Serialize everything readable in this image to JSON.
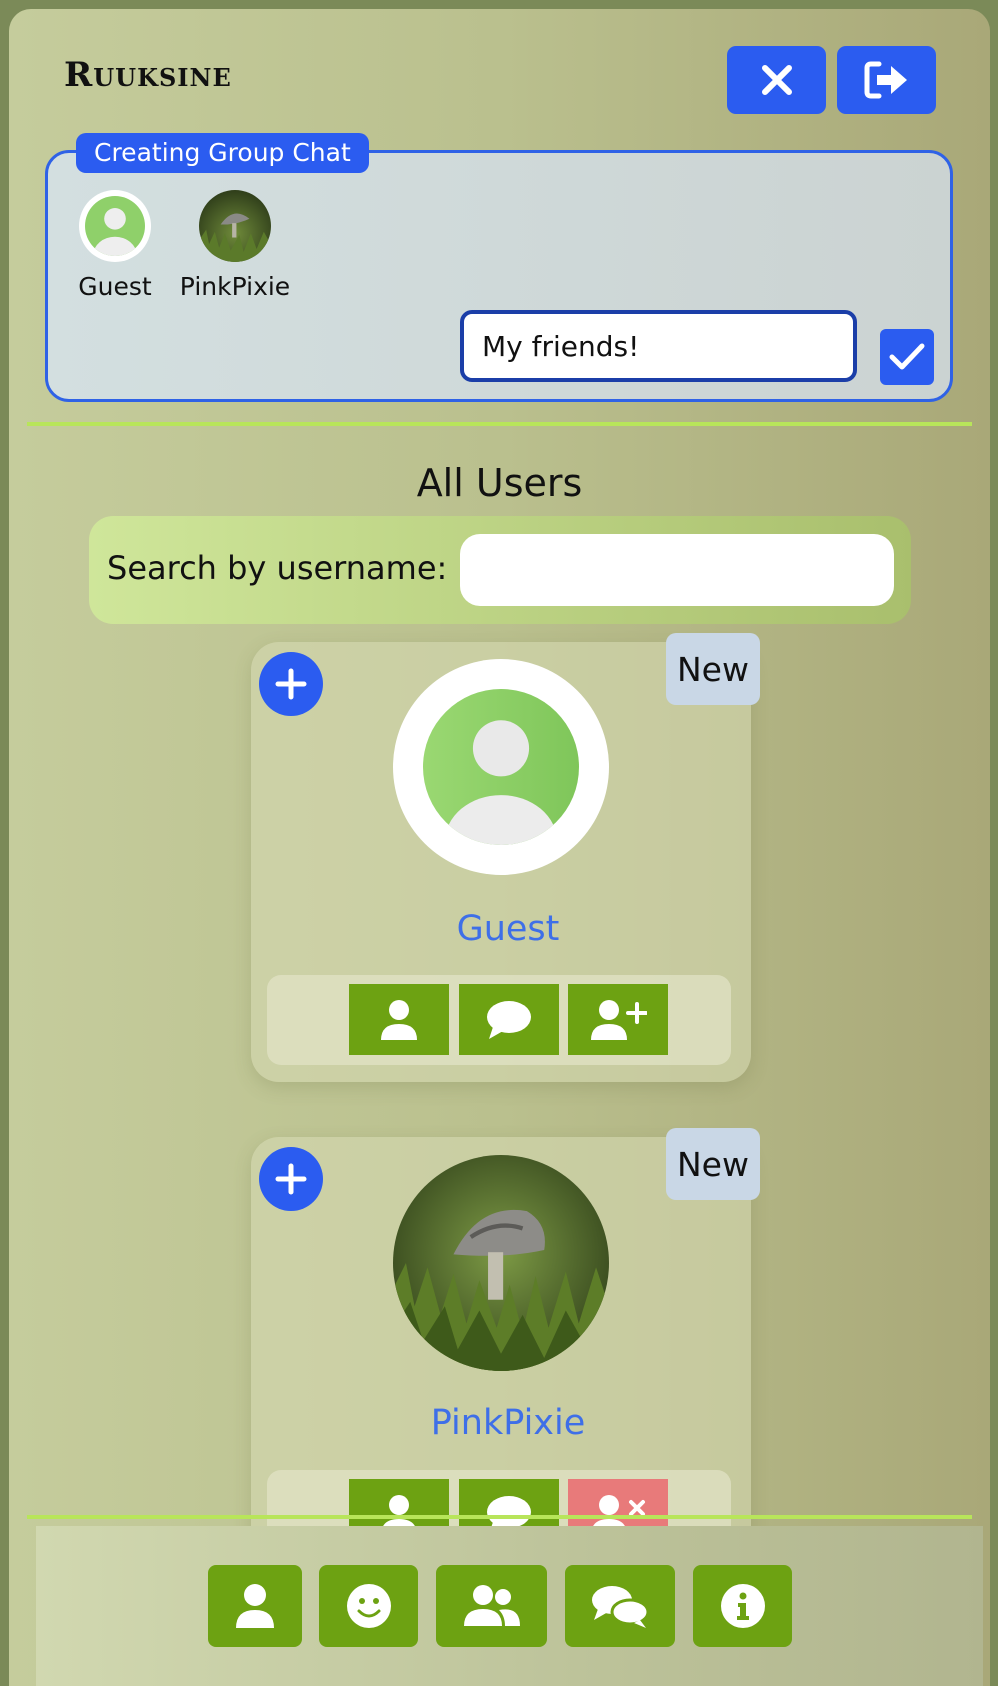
{
  "header": {
    "brand": "Ruuksine",
    "close_icon": "close-icon",
    "logout_icon": "logout-icon"
  },
  "group_chat": {
    "legend": "Creating Group Chat",
    "members": [
      {
        "name": "Guest",
        "avatar": "default-avatar"
      },
      {
        "name": "PinkPixie",
        "avatar": "mushroom-photo"
      }
    ],
    "chat_name_value": "My friends!",
    "confirm_icon": "check-icon"
  },
  "all_users": {
    "title": "All Users",
    "search_label": "Search by username:",
    "search_value": "",
    "users": [
      {
        "name": "Guest",
        "badge": "New",
        "avatar": "default-avatar",
        "actions": [
          "profile-icon",
          "chat-icon",
          "add-friend-icon"
        ]
      },
      {
        "name": "PinkPixie",
        "badge": "New",
        "avatar": "mushroom-photo",
        "actions": [
          "profile-icon",
          "chat-icon",
          "remove-friend-icon"
        ]
      }
    ]
  },
  "bottom_nav": {
    "items": [
      "user-icon",
      "smiley-icon",
      "users-icon",
      "comments-icon",
      "info-icon"
    ]
  },
  "colors": {
    "accent_blue": "#2b5cf0",
    "action_green": "#6da212",
    "remove_red": "#e87a7a",
    "divider_green": "#b8e55a",
    "username_blue": "#3e6fe8"
  }
}
